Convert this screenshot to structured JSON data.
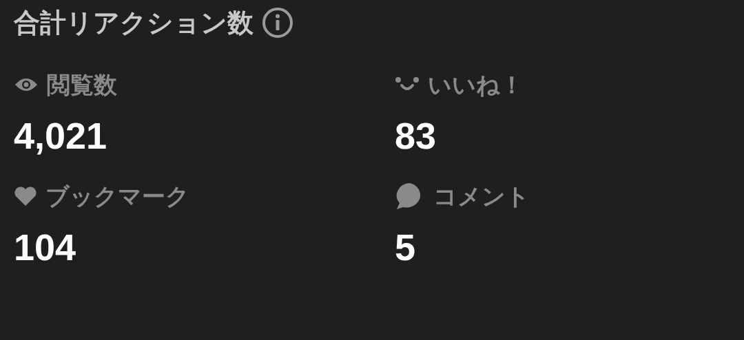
{
  "title": "合計リアクション数",
  "stats": [
    {
      "kind": "eye",
      "label": "閲覧数",
      "value": "4,021"
    },
    {
      "kind": "smile",
      "label": "いいね！",
      "value": "83"
    },
    {
      "kind": "heart",
      "label": "ブックマーク",
      "value": "104"
    },
    {
      "kind": "comment",
      "label": "コメント",
      "value": "5"
    }
  ]
}
